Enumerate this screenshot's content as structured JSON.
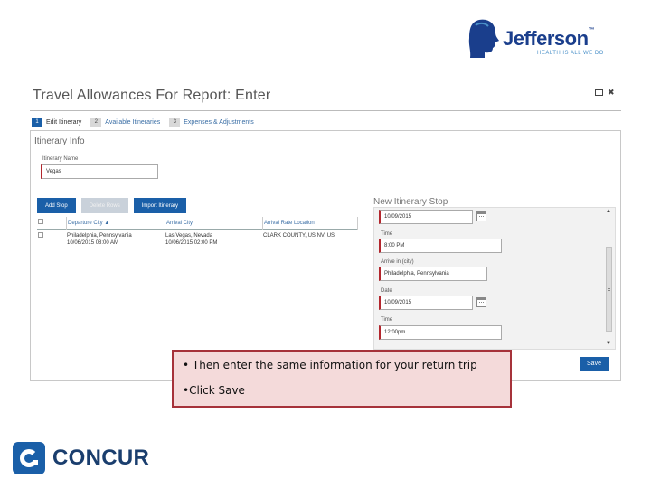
{
  "brand": {
    "jefferson_name": "Jefferson",
    "jefferson_tagline": "HEALTH IS ALL WE DO",
    "concur_name": "CONCUR",
    "colors": {
      "primary_blue": "#1a5fa8",
      "required_red": "#b3262d",
      "callout_border": "#a6323a",
      "callout_bg": "#f4dada"
    }
  },
  "dialog": {
    "title": "Travel Allowances For Report: Enter",
    "steps": [
      {
        "num": "1",
        "label": "Edit Itinerary"
      },
      {
        "num": "2",
        "label": "Available Itineraries"
      },
      {
        "num": "3",
        "label": "Expenses & Adjustments"
      }
    ]
  },
  "itinerary_info": {
    "section_label": "Itinerary Info",
    "name_label": "Itinerary Name",
    "name_value": "Vegas"
  },
  "toolbar": {
    "add_stop": "Add Stop",
    "delete_rows": "Delete Rows",
    "import_itinerary": "Import Itinerary"
  },
  "table": {
    "headers": {
      "departure": "Departure City ▲",
      "arrival": "Arrival City",
      "location": "Arrival Rate Location"
    },
    "rows": [
      {
        "departure_city": "Philadelphia, Pennsylvania",
        "departure_time": "10/06/2015 08:00 AM",
        "arrival_city": "Las Vegas, Nevada",
        "arrival_time": "10/06/2015 02:00 PM",
        "rate_location": "CLARK COUNTY, US NV, US"
      }
    ]
  },
  "new_stop": {
    "title": "New Itinerary Stop",
    "date_value_1": "10/09/2015",
    "time_label_1": "Time",
    "time_value_1": "8:00 PM",
    "arrive_label": "Arrive in (city)",
    "arrive_value": "Philadelphia, Pennsylvania",
    "date_label_2": "Date",
    "date_value_2": "10/09/2015",
    "time_label_2": "Time",
    "time_value_2": "12:00pm"
  },
  "save_label": "Save",
  "callout": {
    "line1": "• Then enter the same information for your return trip",
    "line2": "•Click Save"
  }
}
